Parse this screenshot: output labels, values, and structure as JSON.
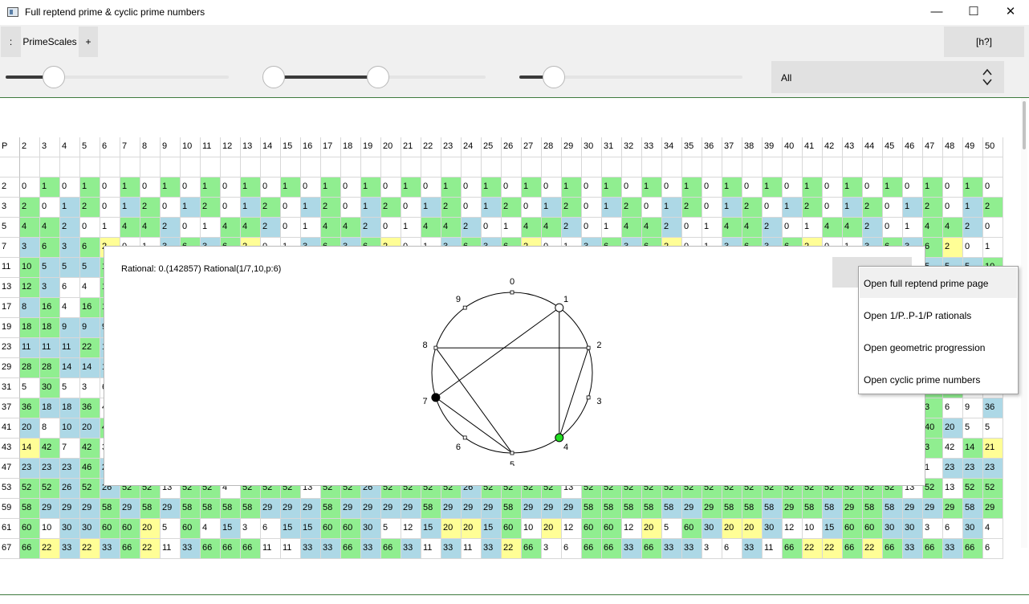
{
  "window": {
    "title": "Full reptend prime & cyclic prime numbers",
    "minimize": "—",
    "maximize": "☐",
    "close": "✕"
  },
  "toolbar": {
    "menu_button": ":",
    "tab_label": "PrimeScales",
    "add_tab_button": "+",
    "help_button": "[h?]",
    "sliders": [
      {
        "value_fraction": 0.2
      },
      {
        "value_fraction": 0.47
      },
      {
        "value_fraction": 0.14
      }
    ],
    "filter": {
      "value": "All"
    }
  },
  "colors": {
    "green": "#90ee90",
    "blue": "#add8e6",
    "yellow": "#fffe96",
    "grid_line": "#d8d8d8",
    "accent_border": "#3e7a3e"
  },
  "grid": {
    "header_label": "P",
    "bases": [
      "2",
      "3",
      "4",
      "5",
      "6",
      "7",
      "8",
      "9",
      "10",
      "11",
      "12",
      "13",
      "14",
      "15",
      "16",
      "17",
      "18",
      "19",
      "20",
      "21",
      "22",
      "23",
      "24",
      "25",
      "26",
      "27",
      "28",
      "29",
      "30",
      "31",
      "32",
      "33",
      "34",
      "35",
      "36",
      "37",
      "38",
      "39",
      "40",
      "41",
      "42",
      "43",
      "44",
      "45",
      "46",
      "47",
      "48",
      "49",
      "50"
    ],
    "primes": [
      "2",
      "3",
      "5",
      "7",
      "11",
      "13",
      "17",
      "19",
      "23",
      "29",
      "31",
      "37",
      "41",
      "43",
      "47",
      "53",
      "59",
      "61",
      "67"
    ],
    "rows": {
      "2": {
        "v": [
          "0",
          "1",
          "0",
          "1",
          "0",
          "1",
          "0",
          "1",
          "0",
          "1",
          "0",
          "1",
          "0",
          "1",
          "0",
          "1",
          "0",
          "1",
          "0",
          "1",
          "0",
          "1",
          "0",
          "1",
          "0",
          "1",
          "0",
          "1",
          "0",
          "1",
          "0",
          "1",
          "0",
          "1",
          "0",
          "1",
          "0",
          "1",
          "0",
          "1",
          "0",
          "1",
          "0",
          "1",
          "0",
          "1",
          "0",
          "1",
          "0"
        ],
        "c": "wgwgwgwgwgwgwgwgwgwgwgwgwgwgwgwgwgwgwgwgwgwgwgwgw"
      },
      "3": {
        "v": [
          "2",
          "0",
          "1",
          "2",
          "0",
          "1",
          "2",
          "0",
          "1",
          "2",
          "0",
          "1",
          "2",
          "0",
          "1",
          "2",
          "0",
          "1",
          "2",
          "0",
          "1",
          "2",
          "0",
          "1",
          "2",
          "0",
          "1",
          "2",
          "0",
          "1",
          "2",
          "0",
          "1",
          "2",
          "0",
          "1",
          "2",
          "0",
          "1",
          "2",
          "0",
          "1",
          "2",
          "0",
          "1",
          "2",
          "0",
          "1",
          "2"
        ],
        "c": "gwbgwbgwbgwbgwbgwbgwbgwbgwbgwbgwbgwbgwbgwbgwbgwbg"
      },
      "5": {
        "v": [
          "4",
          "4",
          "2",
          "0",
          "1",
          "4",
          "4",
          "2",
          "0",
          "1",
          "4",
          "4",
          "2",
          "0",
          "1",
          "4",
          "4",
          "2",
          "0",
          "1",
          "4",
          "4",
          "2",
          "0",
          "1",
          "4",
          "4",
          "2",
          "0",
          "1",
          "4",
          "4",
          "2",
          "0",
          "1",
          "4",
          "4",
          "2",
          "0",
          "1",
          "4",
          "4",
          "2",
          "0",
          "1",
          "4",
          "4",
          "2",
          "0"
        ],
        "c": "ggbwwggbwwggbwwggbwwggbwwggbwwggbwwggbwwggbwwggbw"
      },
      "7": {
        "v": [
          "3",
          "6",
          "3",
          "6",
          "2",
          "0",
          "1",
          "3",
          "6",
          "3",
          "6",
          "2",
          "0",
          "1",
          "3",
          "6",
          "3",
          "6",
          "2",
          "0",
          "1",
          "3",
          "6",
          "3",
          "6",
          "2",
          "0",
          "1",
          "3",
          "6",
          "3",
          "6",
          "2",
          "0",
          "1",
          "3",
          "6",
          "3",
          "6",
          "2",
          "0",
          "1",
          "3",
          "6",
          "3",
          "6",
          "2",
          "0",
          "1"
        ],
        "c": "bgbgywwbgbgywwbgbgywwbgbgywwbgbgywwbgbgywwbgbgyww"
      },
      "11": {
        "v": [
          "10",
          "5",
          "5",
          "5",
          "10",
          "10",
          "10",
          "5",
          "2",
          "0",
          "1",
          "10",
          "5",
          "5",
          "5",
          "10",
          "10",
          "10",
          "5",
          "2",
          "0",
          "1",
          "10",
          "5",
          "5",
          "5",
          "10",
          "10",
          "10",
          "5",
          "2",
          "0",
          "1",
          "10",
          "5",
          "5",
          "5",
          "10",
          "10",
          "10",
          "5",
          "2",
          "0",
          "1",
          "10",
          "5",
          "5",
          "5",
          "10"
        ],
        "c": "gbbbgggbywwgbbbgggbywwgbbbgggbywwgbbbgggbywwgbbbg"
      },
      "13": {
        "v": [
          "12",
          "3",
          "6",
          "4",
          "12",
          "12",
          "4",
          "3",
          "6",
          "12",
          "2",
          "0",
          "1",
          "12",
          "3",
          "6",
          "4",
          "12",
          "12",
          "4",
          "3",
          "6",
          "12",
          "2",
          "0",
          "1",
          "12",
          "3",
          "6",
          "4",
          "12",
          "12",
          "4",
          "3",
          "6",
          "12",
          "2",
          "0",
          "1",
          "12",
          "3",
          "6",
          "4",
          "12",
          "12",
          "4",
          "3",
          "6",
          "12"
        ],
        "c": "gbwwggwbwgywwgbwwggwbwgywwgbwwggwbwgywwgbwwggwbwg"
      },
      "17": {
        "v": [
          "8",
          "16",
          "4",
          "16",
          "16",
          "16",
          "8",
          "8",
          "16",
          "16",
          "16",
          "4",
          "16",
          "8",
          "2",
          "0",
          "1",
          "8",
          "16",
          "4",
          "16",
          "16",
          "16",
          "8",
          "8",
          "16",
          "16",
          "16",
          "4",
          "16",
          "8",
          "2",
          "0",
          "1",
          "8",
          "16",
          "4",
          "16",
          "16",
          "16",
          "8",
          "8",
          "16",
          "16",
          "16",
          "4",
          "16",
          "8",
          "2"
        ],
        "c": "bgwgggbbgggwgbywwbgwgggbbgggwgbywwbgwgggbbgggwgby"
      },
      "19": {
        "v": [
          "18",
          "18",
          "9",
          "9",
          "9",
          "3",
          "6",
          "9",
          "18",
          "3",
          "6",
          "18",
          "18",
          "18",
          "9",
          "9",
          "2",
          "0",
          "1",
          "18",
          "18",
          "9",
          "9",
          "9",
          "3",
          "6",
          "9",
          "18",
          "3",
          "6",
          "18",
          "18",
          "18",
          "9",
          "9",
          "2",
          "0",
          "1",
          "18",
          "18",
          "9",
          "9",
          "9",
          "3",
          "6",
          "9",
          "18",
          "3",
          "6"
        ],
        "c": "ggbbbwwbgwwgggbbywwggbbbwwbgwwgggbbywwggbbbwwbgww"
      },
      "23": {
        "v": [
          "11",
          "11",
          "11",
          "22",
          "11",
          "22",
          "11",
          "11",
          "22",
          "22",
          "11",
          "11",
          "22",
          "22",
          "11",
          "22",
          "11",
          "11",
          "22",
          "2",
          "0",
          "1",
          "11",
          "11",
          "11",
          "22",
          "11",
          "22",
          "11",
          "11",
          "22",
          "22",
          "11",
          "11",
          "22",
          "22",
          "11",
          "22",
          "11",
          "11",
          "22",
          "2",
          "0",
          "1",
          "11",
          "11",
          "11",
          "22",
          "11"
        ],
        "c": "bbbgbgbbggbbggbgbbgywwbbbgbgbbggbbggbgbbgywwbbbgb"
      },
      "29": {
        "v": [
          "28",
          "28",
          "14",
          "14",
          "14",
          "7",
          "28",
          "14",
          "28",
          "28",
          "4",
          "14",
          "28",
          "7",
          "28",
          "28",
          "28",
          "7",
          "28",
          "28",
          "7",
          "4",
          "28",
          "14",
          "28",
          "2",
          "0",
          "1",
          "28",
          "28",
          "14",
          "14",
          "14",
          "7",
          "28",
          "14",
          "28",
          "28",
          "4",
          "14",
          "28",
          "7",
          "28",
          "28",
          "28",
          "7",
          "28",
          "28",
          "7"
        ],
        "c": "ggbbbwgbggwbgwgggwggwwgbgywwggbbbwgbggwbgwgggwggw"
      },
      "31": {
        "v": [
          "5",
          "30",
          "5",
          "3",
          "6",
          "15",
          "3",
          "15",
          "30",
          "30",
          "6",
          "15",
          "30",
          "5",
          "30",
          "30",
          "30",
          "6",
          "5",
          "5",
          "30",
          "15",
          "5",
          "30",
          "10",
          "15",
          "15",
          "2",
          "0",
          "1",
          "5",
          "30",
          "5",
          "3",
          "6",
          "15",
          "3",
          "15",
          "30",
          "30",
          "6",
          "15",
          "30",
          "5",
          "30",
          "30",
          "30",
          "6",
          "5"
        ],
        "c": "wgwwwbwbggwbgwgggwwwgbwgwbbywwwgwwwbwbggwbgwgggww"
      },
      "37": {
        "v": [
          "36",
          "18",
          "18",
          "36",
          "4",
          "9",
          "9",
          "36",
          "3",
          "36",
          "9",
          "36",
          "12",
          "36",
          "36",
          "18",
          "9",
          "9",
          "36",
          "36",
          "4",
          "9",
          "12",
          "36",
          "9",
          "4",
          "36",
          "6",
          "4",
          "36",
          "36",
          "9",
          "36",
          "36",
          "2",
          "0",
          "1",
          "36",
          "18",
          "18",
          "36",
          "4",
          "9",
          "9",
          "36",
          "3",
          "6",
          "9",
          "36"
        ],
        "c": "gbbgwbbgwgbgwgggbbggwbwgbwgwwgggbggywwgbbgwbbgwwbg"
      },
      "41": {
        "v": [
          "20",
          "8",
          "10",
          "20",
          "40",
          "40",
          "20",
          "5",
          "5",
          "40",
          "40",
          "8",
          "40",
          "10",
          "40",
          "10",
          "40",
          "20",
          "20",
          "20",
          "8",
          "40",
          "5",
          "40",
          "40",
          "40",
          "40",
          "10",
          "40",
          "5",
          "40",
          "20",
          "8",
          "40",
          "40",
          "40",
          "10",
          "2",
          "0",
          "1",
          "20",
          "8",
          "10",
          "20",
          "40",
          "40",
          "20",
          "5",
          "5"
        ],
        "c": "bwbbggbwwggwgbgbgbbbwgwggggbgwgbwgggbywwbwbbggbww"
      },
      "43": {
        "v": [
          "14",
          "42",
          "7",
          "42",
          "3",
          "42",
          "14",
          "21",
          "6",
          "7",
          "42",
          "21",
          "21",
          "42",
          "7",
          "42",
          "42",
          "6",
          "21",
          "21",
          "7",
          "42",
          "21",
          "3",
          "21",
          "21",
          "42",
          "7",
          "14",
          "42",
          "14",
          "42",
          "42",
          "6",
          "42",
          "21",
          "6",
          "42",
          "2",
          "0",
          "1",
          "14",
          "42",
          "7",
          "42",
          "3",
          "42",
          "14",
          "21"
        ],
        "c": "ygwgwgybwwgbbgwggwbbwgbwbbgwygygggwgbwgywwygwgwgyb"
      },
      "47": {
        "v": [
          "23",
          "23",
          "23",
          "46",
          "23",
          "23",
          "23",
          "23",
          "46",
          "46",
          "23",
          "46",
          "46",
          "46",
          "23",
          "23",
          "23",
          "46",
          "23",
          "46",
          "23",
          "46",
          "23",
          "46",
          "23",
          "23",
          "46",
          "46",
          "46",
          "46",
          "23",
          "23",
          "23",
          "46",
          "23",
          "23",
          "23",
          "46",
          "46",
          "46",
          "46",
          "23",
          "46",
          "2",
          "0",
          "1",
          "23",
          "23",
          "23"
        ],
        "c": "bbbgbbbbggbgggbbbgbgbgbgbbggggbbbgbbbggggbgywwbbb"
      },
      "53": {
        "v": [
          "52",
          "52",
          "26",
          "52",
          "26",
          "52",
          "52",
          "13",
          "52",
          "52",
          "4",
          "52",
          "52",
          "52",
          "13",
          "52",
          "52",
          "26",
          "52",
          "52",
          "52",
          "52",
          "26",
          "52",
          "52",
          "52",
          "52",
          "13",
          "52",
          "52",
          "52",
          "52",
          "52",
          "52",
          "52",
          "52",
          "52",
          "52",
          "52",
          "52",
          "52",
          "52",
          "52",
          "52",
          "13",
          "52",
          "13",
          "52",
          "52"
        ],
        "c": "ggbgbggwggwgggwggbggggbggggwggggggggggggggggwgwgg"
      },
      "59": {
        "v": [
          "58",
          "29",
          "29",
          "29",
          "58",
          "29",
          "58",
          "29",
          "58",
          "58",
          "58",
          "58",
          "29",
          "29",
          "29",
          "58",
          "29",
          "29",
          "29",
          "29",
          "58",
          "29",
          "29",
          "29",
          "58",
          "29",
          "29",
          "29",
          "58",
          "58",
          "58",
          "58",
          "58",
          "29",
          "29",
          "58",
          "58",
          "58",
          "29",
          "58",
          "58",
          "29",
          "58",
          "58",
          "29",
          "29",
          "29",
          "58",
          "29"
        ],
        "c": "gbbbgbgbggggbbbgbbbbgbbbgbbbggggbbgggbggbggbbbgbg"
      },
      "61": {
        "v": [
          "60",
          "10",
          "30",
          "30",
          "60",
          "60",
          "20",
          "5",
          "60",
          "4",
          "15",
          "3",
          "6",
          "15",
          "15",
          "60",
          "60",
          "30",
          "5",
          "12",
          "15",
          "20",
          "20",
          "15",
          "60",
          "10",
          "20",
          "12",
          "60",
          "60",
          "12",
          "20",
          "5",
          "60",
          "30",
          "20",
          "20",
          "30",
          "12",
          "10",
          "15",
          "60",
          "60",
          "30",
          "30",
          "3",
          "6",
          "30",
          "4"
        ],
        "c": "gwbbggywgwbwwbbggbwwbyybgwywggwywgbyybwwbggbbwwbw"
      },
      "67": {
        "v": [
          "66",
          "22",
          "33",
          "22",
          "33",
          "66",
          "22",
          "11",
          "33",
          "66",
          "66",
          "66",
          "11",
          "11",
          "33",
          "33",
          "66",
          "33",
          "66",
          "33",
          "11",
          "33",
          "11",
          "33",
          "22",
          "66",
          "3",
          "6",
          "66",
          "66",
          "33",
          "66",
          "33",
          "33",
          "3",
          "6",
          "33",
          "11",
          "66",
          "22",
          "22",
          "66",
          "22",
          "66",
          "33",
          "66",
          "33",
          "66",
          "6"
        ],
        "c": "gybybgywbgggwwbbgbgbwbwbygwwggbgbbwwbwgyygygbgbgw"
      }
    }
  },
  "popup": {
    "rational_text": "Rational: 0.(142857) Rational(1/7,10,p:6)",
    "button_label": "",
    "diagram_labels": [
      "0",
      "1",
      "2",
      "3",
      "4",
      "5",
      "6",
      "7",
      "8",
      "9"
    ],
    "cycle_order": [
      1,
      4,
      2,
      8,
      5,
      7
    ],
    "start_digit": 1,
    "current_digit": 4,
    "previous_digit": 7
  },
  "context_menu": {
    "items": [
      "Open full reptend prime page",
      "Open 1/P..P-1/P rationals",
      "Open geometric progression",
      "Open cyclic prime numbers"
    ]
  }
}
